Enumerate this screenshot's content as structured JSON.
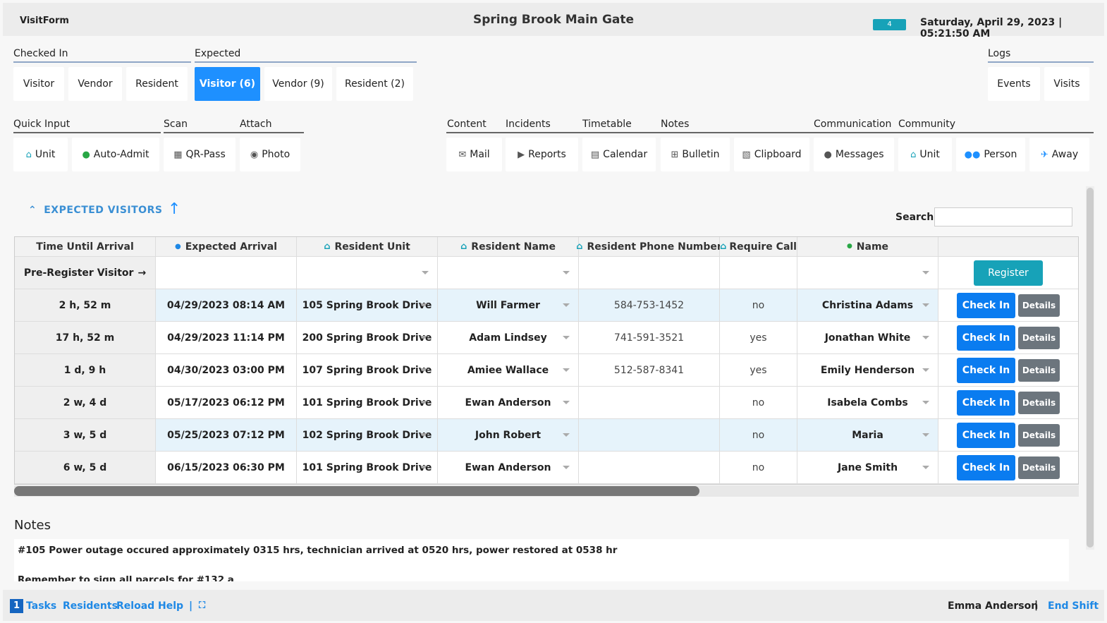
{
  "header": {
    "brand": "VisitForm",
    "gate": "Spring Brook Main Gate",
    "badge": "4",
    "datetime": "Saturday, April 29, 2023 | 05:21:50 AM"
  },
  "checked_in": {
    "label": "Checked In",
    "buttons": [
      "Visitor",
      "Vendor",
      "Resident"
    ]
  },
  "expected": {
    "label": "Expected",
    "buttons": [
      "Visitor (6)",
      "Vendor (9)",
      "Resident (2)"
    ]
  },
  "logs": {
    "label": "Logs",
    "buttons": [
      "Events",
      "Visits"
    ]
  },
  "quick_input": {
    "label": "Quick Input",
    "unit": "Unit",
    "auto_admit": "Auto-Admit"
  },
  "scan": {
    "label": "Scan",
    "qr_pass": "QR-Pass"
  },
  "attach": {
    "label": "Attach",
    "photo": "Photo"
  },
  "toolbar": {
    "content": "Content",
    "incidents": "Incidents",
    "timetable": "Timetable",
    "notes": "Notes",
    "communication": "Communication",
    "community": "Community",
    "mail": "Mail",
    "reports": "Reports",
    "calendar": "Calendar",
    "bulletin": "Bulletin",
    "clipboard": "Clipboard",
    "messages": "Messages",
    "unit": "Unit",
    "person": "Person",
    "away": "Away"
  },
  "section": {
    "title": "EXPECTED VISITORS",
    "search_label": "Search:",
    "search_value": ""
  },
  "table": {
    "columns": [
      "Time Until Arrival",
      "Expected Arrival",
      "Resident Unit",
      "Resident Name",
      "Resident Phone Number",
      "Require Call",
      "Name",
      ""
    ],
    "pre_register": "Pre-Register Visitor",
    "register": "Register",
    "check_in": "Check In",
    "details": "Details",
    "rows": [
      {
        "time": "2 h, 52 m",
        "arrival": "04/29/2023 08:14 AM",
        "unit": "105 Spring Brook Drive",
        "resident": "Will Farmer",
        "phone": "584-753-1452",
        "call": "no",
        "name": "Christina Adams"
      },
      {
        "time": "17 h, 52 m",
        "arrival": "04/29/2023 11:14 PM",
        "unit": "200 Spring Brook Drive",
        "resident": "Adam Lindsey",
        "phone": "741-591-3521",
        "call": "yes",
        "name": "Jonathan White"
      },
      {
        "time": "1 d, 9 h",
        "arrival": "04/30/2023 03:00 PM",
        "unit": "107 Spring Brook Drive",
        "resident": "Amiee Wallace",
        "phone": "512-587-8341",
        "call": "yes",
        "name": "Emily Henderson"
      },
      {
        "time": "2 w, 4 d",
        "arrival": "05/17/2023 06:12 PM",
        "unit": "101 Spring Brook Drive",
        "resident": "Ewan Anderson",
        "phone": "",
        "call": "no",
        "name": "Isabela Combs"
      },
      {
        "time": "3 w, 5 d",
        "arrival": "05/25/2023 07:12 PM",
        "unit": "102 Spring Brook Drive",
        "resident": "John Robert",
        "phone": "",
        "call": "no",
        "name": "Maria"
      },
      {
        "time": "6 w, 5 d",
        "arrival": "06/15/2023 06:30 PM",
        "unit": "101 Spring Brook Drive",
        "resident": "Ewan Anderson",
        "phone": "",
        "call": "no",
        "name": "Jane Smith"
      }
    ]
  },
  "notes": {
    "title": "Notes",
    "lines": [
      "#105 Power outage occured approximately 0315 hrs, technician arrived at 0520 hrs, power restored at 0538 hr",
      "Remember to sign all parcels for #132 a"
    ]
  },
  "footer": {
    "task_count": "1",
    "tasks": "Tasks",
    "residents": "Residents",
    "reload": "Reload",
    "help": "Help",
    "divider": "|",
    "user": "Emma Anderson",
    "end_shift": "End Shift"
  },
  "colors": {
    "primary": "#1e90ff",
    "teal": "#17a2b8",
    "check_in": "#0a7cf0",
    "details": "#6c757d"
  },
  "icons": [
    "home-icon",
    "user-icon",
    "qr-icon",
    "camera-icon",
    "mail-icon",
    "megaphone-icon",
    "calendar-icon",
    "plus-square-icon",
    "clipboard-icon",
    "chat-icon",
    "users-icon",
    "plane-icon",
    "clock-icon",
    "chevron-up-icon",
    "arrow-up-icon",
    "arrow-right-icon",
    "fullscreen-icon"
  ]
}
